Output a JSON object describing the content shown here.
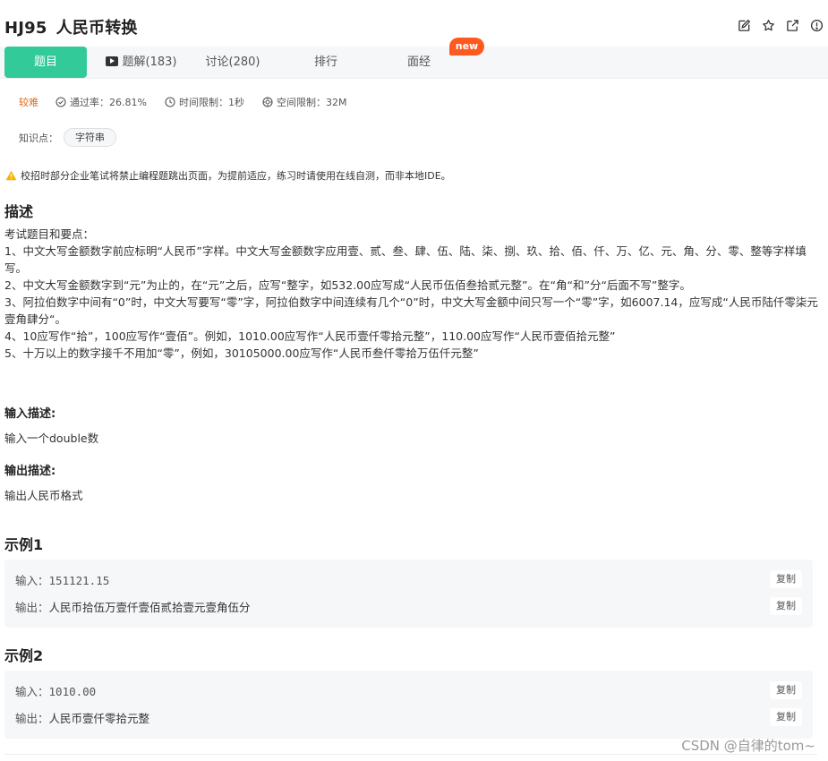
{
  "header": {
    "code": "HJ95",
    "title": "人民币转换",
    "icons": [
      "edit-icon",
      "star-icon",
      "share-icon",
      "report-icon"
    ]
  },
  "tabs": [
    {
      "label": "题目",
      "active": true
    },
    {
      "label": "题解(183)",
      "icon": "video-icon"
    },
    {
      "label": "讨论(280)"
    },
    {
      "label": "排行"
    },
    {
      "label": "面经"
    }
  ],
  "new_badge": "new",
  "meta": {
    "difficulty": "较难",
    "pass_rate": "通过率：26.81%",
    "time_limit": "时间限制：1秒",
    "space_limit": "空间限制：32M"
  },
  "knowledge": {
    "label": "知识点：",
    "tag": "字符串"
  },
  "warning": "校招时部分企业笔试将禁止编程题跳出页面，为提前适应，练习时请使用在线自测，而非本地IDE。",
  "description": {
    "heading": "描述",
    "lines": [
      "考试题目和要点：",
      "1、中文大写金额数字前应标明“人民币”字样。中文大写金额数字应用壹、贰、叁、肆、伍、陆、柒、捌、玖、拾、佰、仟、万、亿、元、角、分、零、整等字样填写。",
      "2、中文大写金额数字到“元”为止的，在“元”之后，应写“整字，如532.00应写成“人民币伍佰叁拾贰元整”。在“角“和”分“后面不写”整字。",
      "3、阿拉伯数字中间有“0”时，中文大写要写“零”字，阿拉伯数字中间连续有几个“0”时，中文大写金额中间只写一个“零”字，如6007.14，应写成“人民币陆仟零柒元壹角肆分“。",
      "4、10应写作“拾”，100应写作“壹佰”。例如，1010.00应写作“人民币壹仟零拾元整”，110.00应写作“人民币壹佰拾元整”",
      "5、十万以上的数字接千不用加“零”，例如，30105000.00应写作“人民币叁仟零拾万伍仟元整”"
    ]
  },
  "input_desc": {
    "heading": "输入描述:",
    "text": "输入一个double数"
  },
  "output_desc": {
    "heading": "输出描述:",
    "text": "输出人民币格式"
  },
  "examples": [
    {
      "heading": "示例1",
      "input_label": "输入：",
      "input": "151121.15",
      "output_label": "输出：",
      "output": "人民币拾伍万壹仟壹佰贰拾壹元壹角伍分",
      "copy": "复制"
    },
    {
      "heading": "示例2",
      "input_label": "输入：",
      "input": "1010.00",
      "output_label": "输出：",
      "output": "人民币壹仟零拾元整",
      "copy": "复制"
    }
  ],
  "watermark": "CSDN @自律的tom~",
  "colors": {
    "accent": "#32ca99",
    "difficulty": "#e06a1b",
    "new_badge": "#fd5a22",
    "warning": "#f5b300"
  }
}
